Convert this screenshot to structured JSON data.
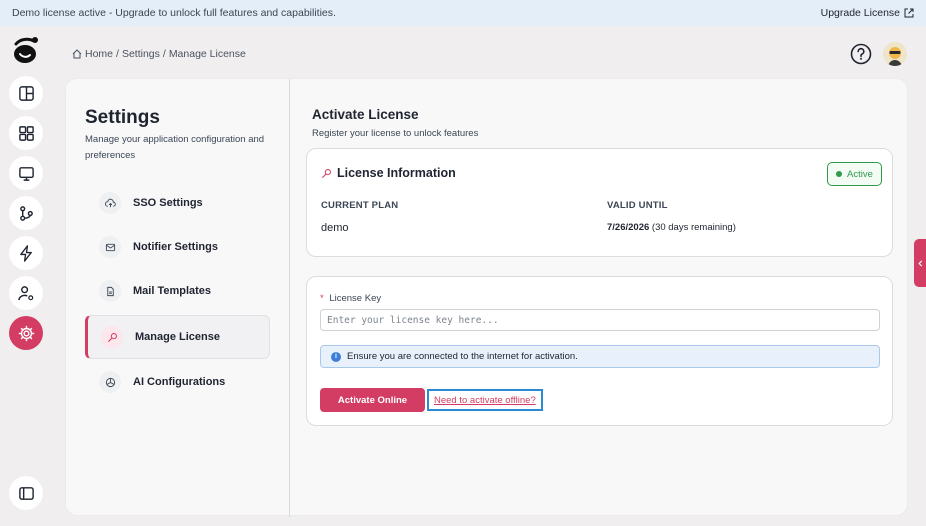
{
  "banner": {
    "text": "Demo license active - Upgrade to unlock full features and capabilities.",
    "upgrade_label": "Upgrade License"
  },
  "breadcrumb": {
    "home": "Home",
    "sep1": "/",
    "settings": "Settings",
    "sep2": "/",
    "current": "Manage License"
  },
  "settings": {
    "title": "Settings",
    "subtitle": "Manage your application configuration and preferences",
    "nav": [
      {
        "label": "SSO Settings",
        "icon": "cloud-upload-icon"
      },
      {
        "label": "Notifier Settings",
        "icon": "mail-icon"
      },
      {
        "label": "Mail Templates",
        "icon": "document-icon"
      },
      {
        "label": "Manage License",
        "icon": "key-icon",
        "active": true
      },
      {
        "label": "AI Configurations",
        "icon": "ai-icon"
      }
    ]
  },
  "main": {
    "title": "Activate License",
    "subtitle": "Register your license to unlock features"
  },
  "license_info": {
    "title": "License Information",
    "status": "Active",
    "plan_label": "CURRENT PLAN",
    "plan_value": "demo",
    "valid_label": "VALID UNTIL",
    "valid_date": "7/26/2026",
    "valid_remaining": "(30 days remaining)"
  },
  "activation": {
    "required_mark": "*",
    "key_label": "License Key",
    "key_placeholder": "Enter your license key here...",
    "key_value": "",
    "notice": "Ensure you are connected to the internet for activation.",
    "activate_label": "Activate Online",
    "offline_label": "Need to activate offline?"
  },
  "colors": {
    "accent": "#d33d63",
    "success": "#2f9a4b",
    "info": "#3d7ed9",
    "focus": "#2b8ad6"
  }
}
